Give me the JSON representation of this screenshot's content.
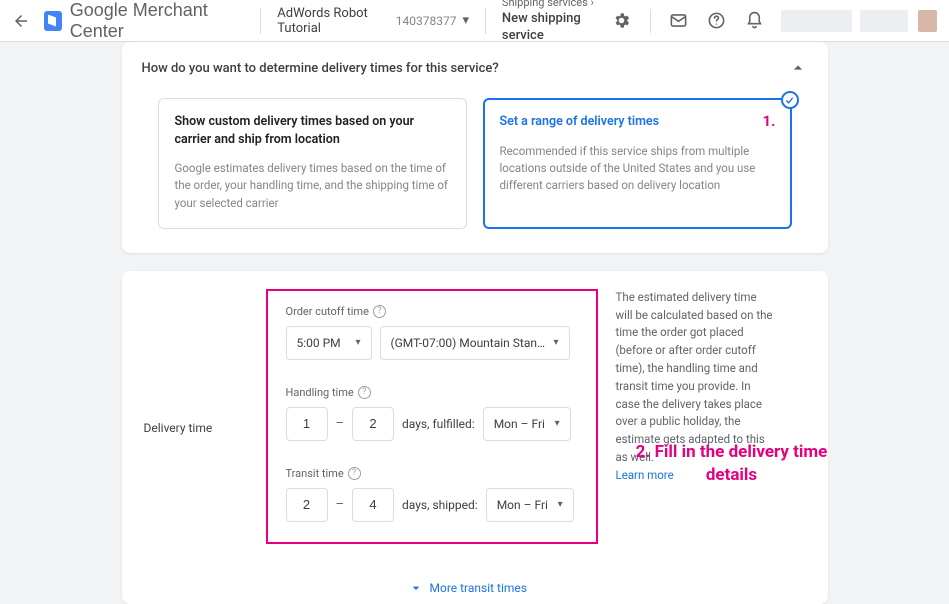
{
  "header": {
    "brand": "Google Merchant Center",
    "account_name": "AdWords Robot Tutorial",
    "account_id": "140378377",
    "breadcrumb_parent": "Shipping services",
    "breadcrumb_current": "New shipping service"
  },
  "card1": {
    "title": "How do you want to determine delivery times for this service?",
    "option_a": {
      "title": "Show custom delivery times based on your carrier and ship from location",
      "desc": "Google estimates delivery times based on the time of the order, your handling time, and the shipping time of your selected carrier"
    },
    "option_b": {
      "title": "Set a range of delivery times",
      "desc": "Recommended if this service ships from multiple locations outside of the United States and you use different carriers based on delivery location"
    }
  },
  "annotations": {
    "one": "1.",
    "two": "2. Fill in the delivery time details"
  },
  "delivery": {
    "section_label": "Delivery time",
    "cutoff_label": "Order cutoff time",
    "cutoff_time": "5:00 PM",
    "cutoff_tz": "(GMT-07:00) Mountain Stand…",
    "handling_label": "Handling time",
    "handling_min": "1",
    "handling_max": "2",
    "handling_suffix": "days, fulfilled:",
    "handling_days": "Mon – Fri",
    "transit_label": "Transit time",
    "transit_min": "2",
    "transit_max": "4",
    "transit_suffix": "days, shipped:",
    "transit_days": "Mon – Fri",
    "more_transit": "More transit times",
    "info": "The estimated delivery time will be calculated based on the time the order got placed (before or after order cutoff time), the handling time and transit time you provide. In case the delivery takes place over a public holiday, the estimate gets adapted to this as well.",
    "learn_more": "Learn more"
  }
}
